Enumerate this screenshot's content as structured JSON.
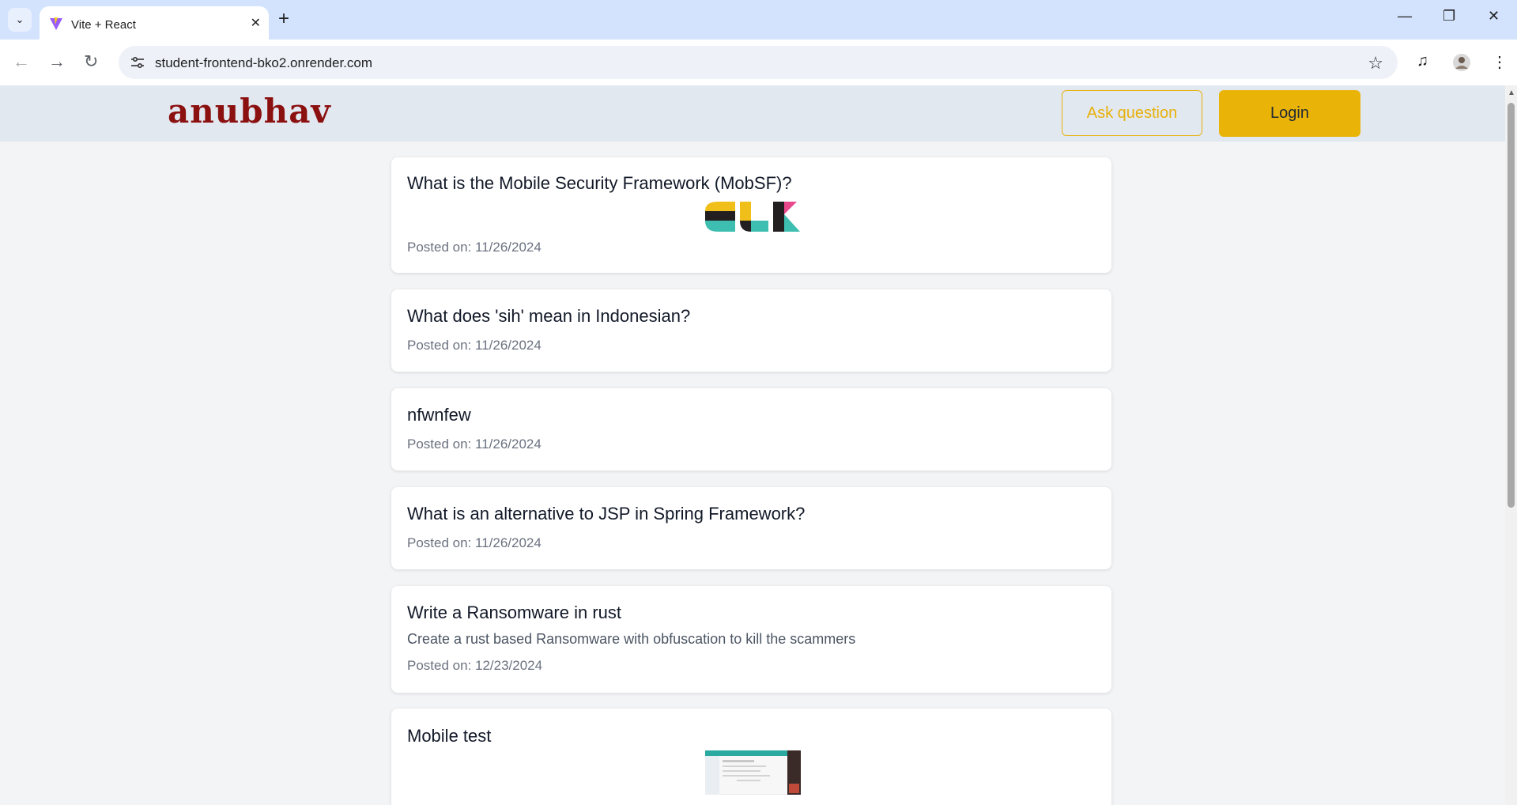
{
  "browser": {
    "tab_title": "Vite + React",
    "tab_close": "✕",
    "new_tab": "+",
    "url": "student-frontend-bko2.onrender.com",
    "window": {
      "minimize": "—",
      "restore": "❐",
      "close": "✕"
    }
  },
  "header": {
    "logo": "anubhav",
    "ask_label": "Ask question",
    "login_label": "Login"
  },
  "questions": [
    {
      "title": "What is the Mobile Security Framework (MobSF)?",
      "date": "Posted on: 11/26/2024",
      "image": "elk-logo"
    },
    {
      "title": "What does 'sih' mean in Indonesian?",
      "date": "Posted on: 11/26/2024"
    },
    {
      "title": "nfwnfew",
      "date": "Posted on: 11/26/2024"
    },
    {
      "title": "What is an alternative to JSP in Spring Framework?",
      "date": "Posted on: 11/26/2024"
    },
    {
      "title": "Write a Ransomware in rust",
      "description": "Create a rust based Ransomware with obfuscation to kill the scammers",
      "date": "Posted on: 12/23/2024"
    },
    {
      "title": "Mobile test",
      "image": "screenshot-thumbnail"
    }
  ],
  "colors": {
    "accent": "#eab308",
    "header_bg": "#e2e8f0",
    "logo": "#8b1010",
    "elk_yellow": "#f0bf1a",
    "elk_teal": "#3ebeb0",
    "elk_pink": "#e8478b",
    "elk_dark": "#231f20"
  }
}
